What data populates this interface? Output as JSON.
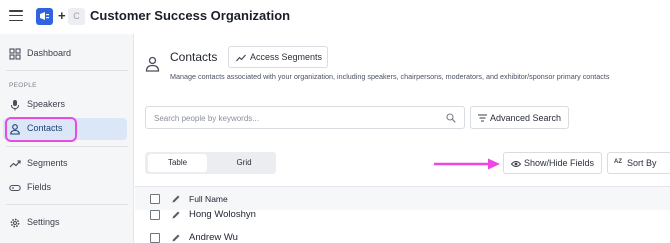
{
  "header": {
    "org_title": "Customer Success Organization",
    "logo_letter": "C",
    "plus": "+"
  },
  "sidebar": {
    "dashboard": "Dashboard",
    "section_people": "PEOPLE",
    "speakers": "Speakers",
    "contacts": "Contacts",
    "segments": "Segments",
    "fields": "Fields",
    "settings": "Settings"
  },
  "main": {
    "title": "Contacts",
    "access_segments": "Access Segments",
    "subtitle": "Manage contacts associated with your organization, including speakers, chairpersons, moderators, and exhibitor/sponsor primary contacts",
    "search_placeholder": "Search people by keywords...",
    "advanced_search": "Advanced Search",
    "view_toggle": {
      "table": "Table",
      "grid": "Grid",
      "selected": "Table"
    },
    "show_hide_fields": "Show/Hide Fields",
    "sort_by": "Sort By",
    "sort_icon": "AZ",
    "table": {
      "columns": [
        "Full Name"
      ],
      "rows": [
        {
          "full_name": "Hong Woloshyn"
        },
        {
          "full_name": "Andrew Wu"
        }
      ]
    }
  },
  "colors": {
    "accent": "#2f63e0",
    "highlight": "#e94be0",
    "active_nav_bg": "#dbe7f7"
  }
}
